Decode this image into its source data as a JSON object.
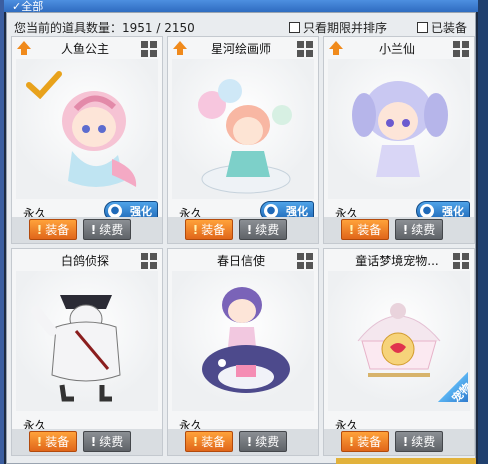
{
  "tab": {
    "label": "全部"
  },
  "header": {
    "count_label": "您当前的道具数量：1951 / 2150",
    "only_expiring": "只看期限并排序",
    "equipped": "已装备"
  },
  "labels": {
    "equip": "装备",
    "renew": "续费",
    "strengthen": "强化"
  },
  "cards": [
    {
      "name": "人鱼公主",
      "duration": "永久",
      "selected": true,
      "strengthen": true
    },
    {
      "name": "星河绘画师",
      "duration": "永久",
      "selected": false,
      "strengthen": true
    },
    {
      "name": "小兰仙",
      "duration": "永久",
      "selected": false,
      "strengthen": true
    },
    {
      "name": "白鸽侦探",
      "duration": "永久",
      "selected": false,
      "strengthen": false
    },
    {
      "name": "春日信使",
      "duration": "永久",
      "selected": false,
      "strengthen": false
    },
    {
      "name": "童话梦境宠物...",
      "duration": "永久",
      "selected": false,
      "strengthen": false,
      "seal": "宠物"
    }
  ],
  "colors": {
    "accent": "#f08a1c",
    "blue": "#2f6cc0"
  },
  "icons": {
    "sort": "orange-up-arrow-icon",
    "view": "grid-icon",
    "checkmark": "gold-check-icon",
    "paw": "paw-icon"
  }
}
